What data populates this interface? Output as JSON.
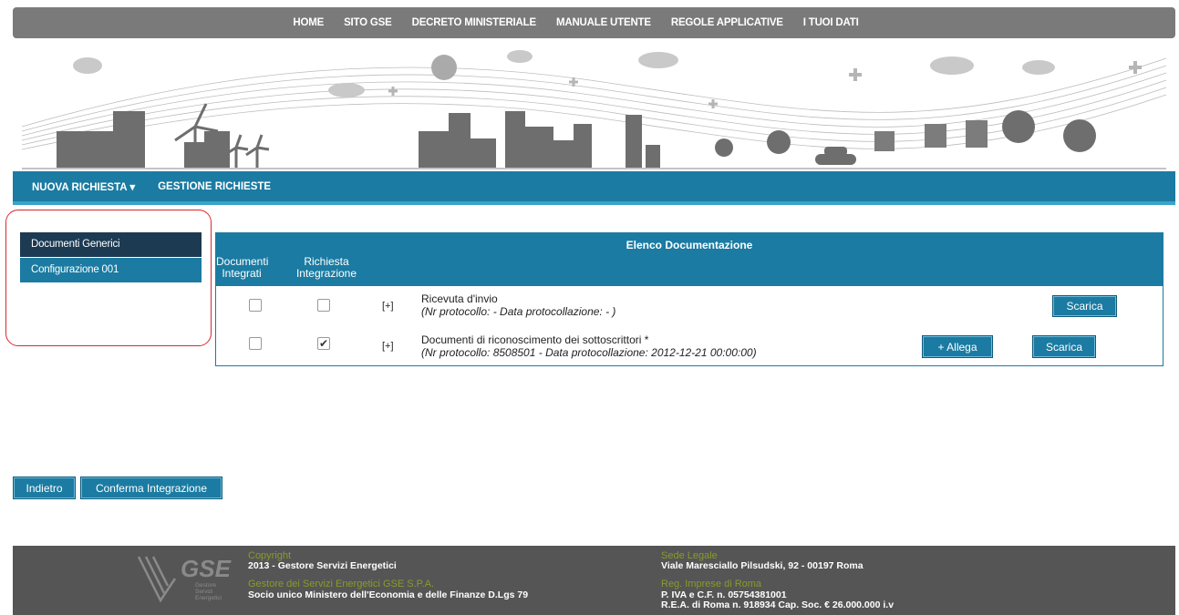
{
  "top_nav": [
    "HOME",
    "SITO GSE",
    "DECRETO MINISTERIALE",
    "MANUALE UTENTE",
    "REGOLE APPLICATIVE",
    "I TUOI DATI"
  ],
  "sub_nav": {
    "nuova_richiesta": "NUOVA RICHIESTA ▾",
    "gestione_richieste": "GESTIONE RICHIESTE"
  },
  "sidebar": {
    "items": [
      "Documenti Generici",
      "Configurazione 001"
    ]
  },
  "panel": {
    "title": "Elenco Documentazione",
    "col_documenti": "Documenti Integrati",
    "col_richiesta": "Richiesta Integrazione",
    "rows": [
      {
        "expand": "[+]",
        "title": "Ricevuta d'invio",
        "subtitle": "(Nr protocollo: - Data protocollazione: - )",
        "documenti_integrati": false,
        "richiesta_integrazione": false,
        "scarica": "Scarica"
      },
      {
        "expand": "[+]",
        "title": "Documenti di riconoscimento dei sottoscrittori *",
        "subtitle": "(Nr protocollo: 8508501 - Data protocollazione: 2012-12-21 00:00:00)",
        "documenti_integrati": false,
        "richiesta_integrazione": true,
        "allega": "+ Allega",
        "scarica": "Scarica"
      }
    ]
  },
  "buttons": {
    "indietro": "Indietro",
    "conferma": "Conferma Integrazione"
  },
  "footer": {
    "logo_text": "GSE",
    "logo_sub": "Gestore Servizi Energetici",
    "copyright_label": "Copyright",
    "copyright_value": "2013 - Gestore Servizi Energetici",
    "company_label": "Gestore dei Servizi Energetici GSE S.P.A.",
    "company_value": "Socio unico Ministero dell'Economia e delle Finanze D.Lgs 79",
    "sede_label": "Sede Legale",
    "sede_value": "Viale Maresciallo Pilsudski, 92 - 00197 Roma",
    "reg_label": "Reg. Imprese di Roma",
    "reg_value_1": "P. IVA e C.F. n. 05754381001",
    "reg_value_2": "R.E.A. di Roma n. 918934 Cap. Soc. € 26.000.000 i.v"
  },
  "colors": {
    "primary": "#1b7ba2",
    "dark": "#1c3a52",
    "nav": "#7a7a7a",
    "footer": "#555555",
    "highlight": "#d9292b"
  }
}
